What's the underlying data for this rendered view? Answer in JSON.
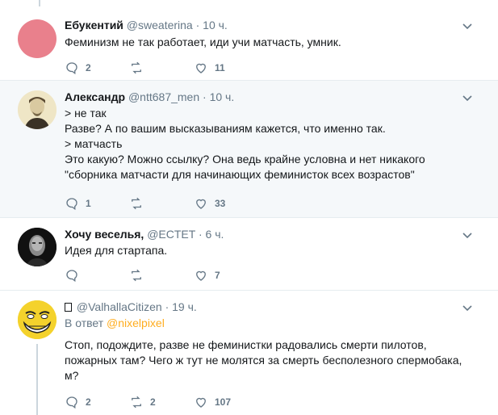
{
  "tweets": [
    {
      "name": "Ебукентий",
      "handle": "@sweaterina",
      "time": "10 ч.",
      "lines": [
        "Феминизм не так работает, иди учи матчасть, умник."
      ],
      "replies": "2",
      "retweets": "",
      "likes": "11"
    },
    {
      "name": "Александр",
      "handle": "@ntt687_men",
      "time": "10 ч.",
      "lines": [
        "> не так",
        "Разве? А по вашим высказываниям кажется, что именно так.",
        "> матчасть",
        "Это какую? Можно ссылку? Она ведь крайне условна и нет никакого",
        "\"сборника матчасти для начинающих феминисток всех возрастов\""
      ],
      "replies": "1",
      "retweets": "",
      "likes": "33"
    },
    {
      "name": "Хочу веселья,",
      "handle": "@ECTET",
      "time": "6 ч.",
      "lines": [
        "Идея для стартапа."
      ],
      "replies": "",
      "retweets": "",
      "likes": "7"
    },
    {
      "name": "",
      "handle": "@ValhallaCitizen",
      "time": "19 ч.",
      "reply_prefix": "В ответ",
      "reply_mention": "@nixelpixel",
      "lines": [
        "Стоп, подождите, разве не феминистки радовались смерти пилотов,",
        "пожарных там? Чего ж тут не молятся за смерть бесполезного спермобака,",
        "м?"
      ],
      "replies": "2",
      "retweets": "2",
      "likes": "107"
    }
  ],
  "separator": "·",
  "colors": {
    "name": "#14171a",
    "meta": "#657786",
    "mention": "#ffad1f",
    "highlight_bg": "#f5f8fa",
    "border": "#e6ecf0",
    "avatar_pink": "#e9808c"
  }
}
